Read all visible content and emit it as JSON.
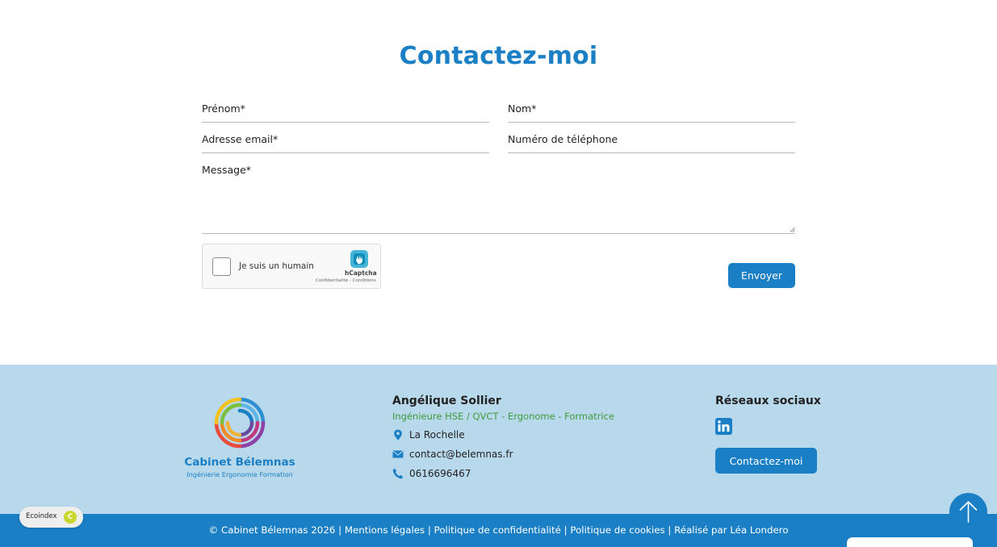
{
  "title": "Contactez-moi",
  "form": {
    "prenom": "Prénom*",
    "nom": "Nom*",
    "email": "Adresse email*",
    "telephone": "Numéro de téléphone",
    "message": "Message*",
    "submit": "Envoyer"
  },
  "captcha": {
    "label": "Je suis un humain",
    "brand": "hCaptcha",
    "links": "Confidentialité - Conditions"
  },
  "footer": {
    "logo_name": "Cabinet Bélemnas",
    "logo_sub": "Ingénierie Ergonomie Formation",
    "contact_name": "Angélique Sollier",
    "contact_role": "Ingénieure HSE / QVCT -  Ergonome - Formatrice",
    "city": "La Rochelle",
    "email": "contact@belemnas.fr",
    "phone": "0616696467",
    "social_title": "Réseaux sociaux",
    "contact_button": "Contactez-moi"
  },
  "bottom": {
    "copyright": "© Cabinet Bélemnas 2026",
    "sep": " | ",
    "legal": "Mentions légales",
    "privacy": "Politique de confidentialité",
    "cookies": "Politique de cookies",
    "credit": "Réalisé par Léa Londero"
  },
  "ecoindex": {
    "label": "Ecoindex",
    "grade": "C"
  },
  "colors": {
    "accent": "#1a7fc4",
    "footer_bg": "#b8d9ec",
    "role_green": "#3f9a3c"
  },
  "icons": [
    "map-pin-icon",
    "mail-icon",
    "phone-icon",
    "linkedin-icon",
    "arrow-up-icon",
    "hcaptcha-logo-icon"
  ]
}
